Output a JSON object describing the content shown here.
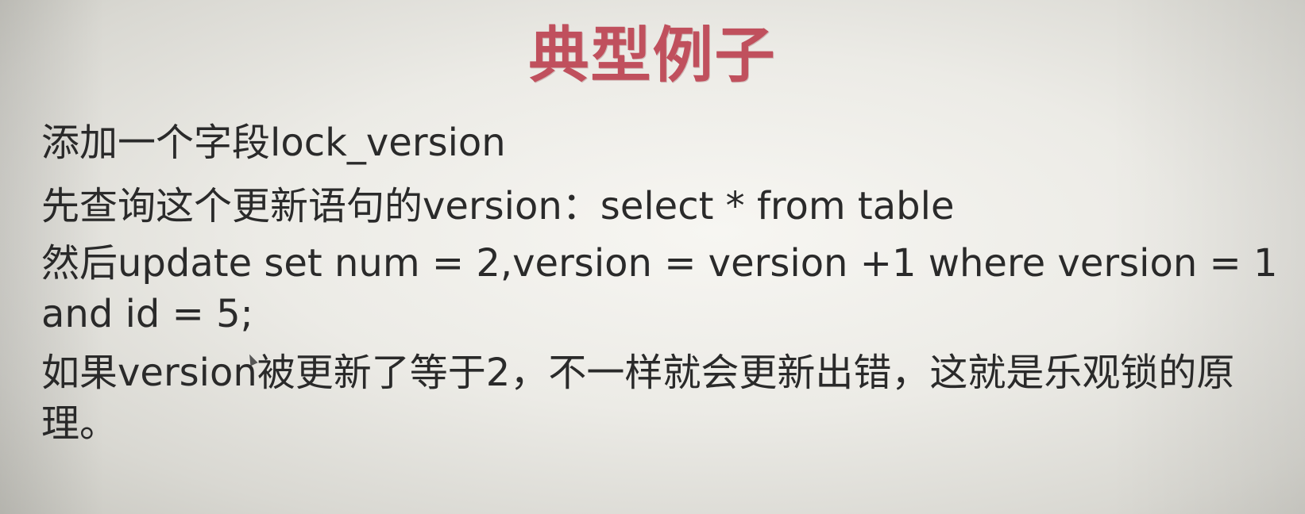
{
  "slide": {
    "title": "典型例子",
    "lines": [
      "添加一个字段lock_version",
      "先查询这个更新语句的version：select * from table",
      "然后update set num = 2,version = version +1 where version = 1 and id = 5;",
      "如果version被更新了等于2，不一样就会更新出错，这就是乐观锁的原理。"
    ]
  },
  "colors": {
    "title": "#c0505d",
    "text": "#2a2a2a",
    "background": "#ecebe6"
  },
  "icons": [
    "mouse-pointer-icon"
  ]
}
